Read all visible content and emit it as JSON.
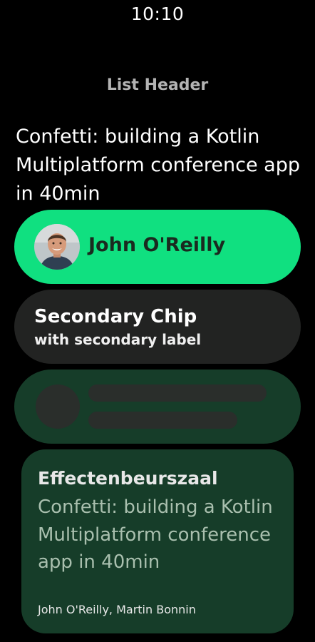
{
  "status_bar": {
    "time": "10:10"
  },
  "list_header": "List Header",
  "talk_title": "Confetti: building a Kotlin Multiplatform conference app in 40min",
  "primary_chip": {
    "label": "John O'Reilly",
    "avatar_icon": "speaker-avatar-photo",
    "color": "#10e080"
  },
  "secondary_chip": {
    "label": "Secondary Chip",
    "secondary_label": "with secondary label",
    "color": "#222322"
  },
  "placeholder_chip": {
    "color": "#163d29"
  },
  "session_card": {
    "room": "Effectenbeurszaal",
    "title": "Confetti: building a Kotlin Multiplatform conference app in 40min",
    "speakers": "John O'Reilly, Martin Bonnin",
    "color": "#163d29"
  }
}
